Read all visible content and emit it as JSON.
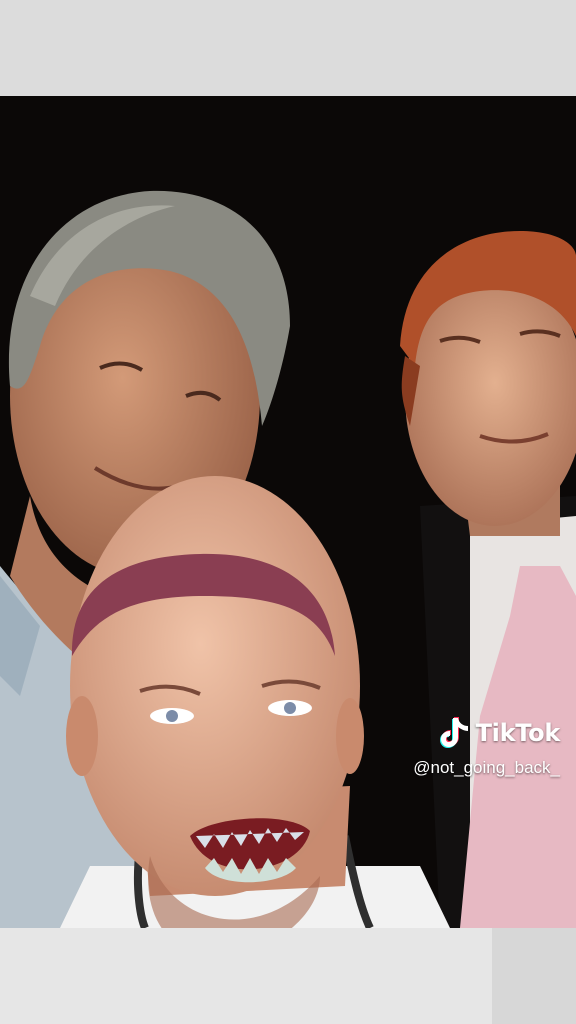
{
  "watermark": {
    "brand": "TikTok",
    "handle": "@not_going_back_"
  },
  "icons": {
    "logo": "tiktok-note-icon"
  },
  "colors": {
    "top_bar": "#dcdcdc",
    "photo_background": "#0b0807",
    "watermark_text": "#ffffff"
  }
}
